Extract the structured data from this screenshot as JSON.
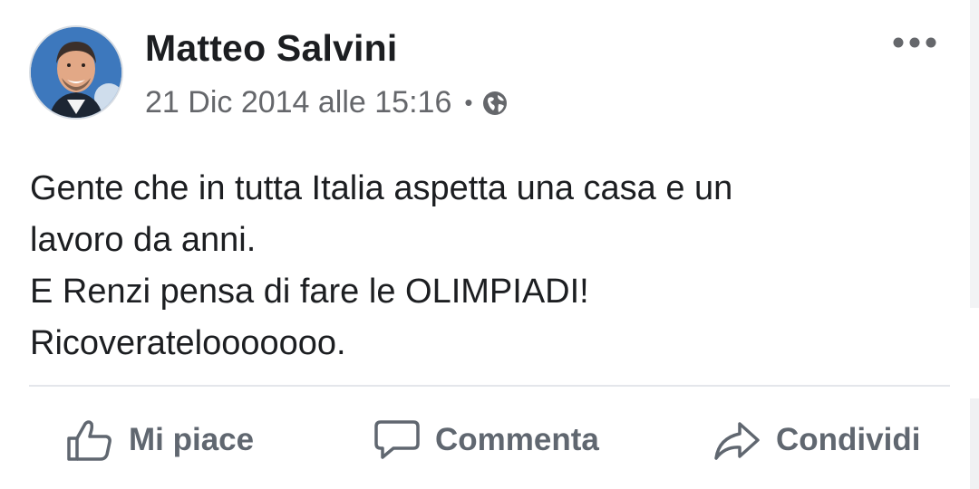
{
  "post": {
    "author": "Matteo Salvini",
    "timestamp": "21 Dic 2014 alle 15:16",
    "separator": "•",
    "privacy_icon": "globe-icon",
    "more_icon": "ellipsis-icon",
    "text_lines": [
      "Gente che in tutta Italia aspetta una casa e un",
      "lavoro da anni.",
      "E Renzi pensa di fare le OLIMPIADI!",
      "Ricoveratelooooooo."
    ]
  },
  "actions": {
    "like": {
      "label": "Mi piace",
      "icon": "thumbs-up-icon"
    },
    "comment": {
      "label": "Commenta",
      "icon": "speech-bubble-icon"
    },
    "share": {
      "label": "Condividi",
      "icon": "share-arrow-icon"
    }
  },
  "colors": {
    "primary_text": "#1c1e21",
    "secondary_text": "#65676b",
    "action_text": "#606770",
    "divider": "#e4e6eb"
  }
}
